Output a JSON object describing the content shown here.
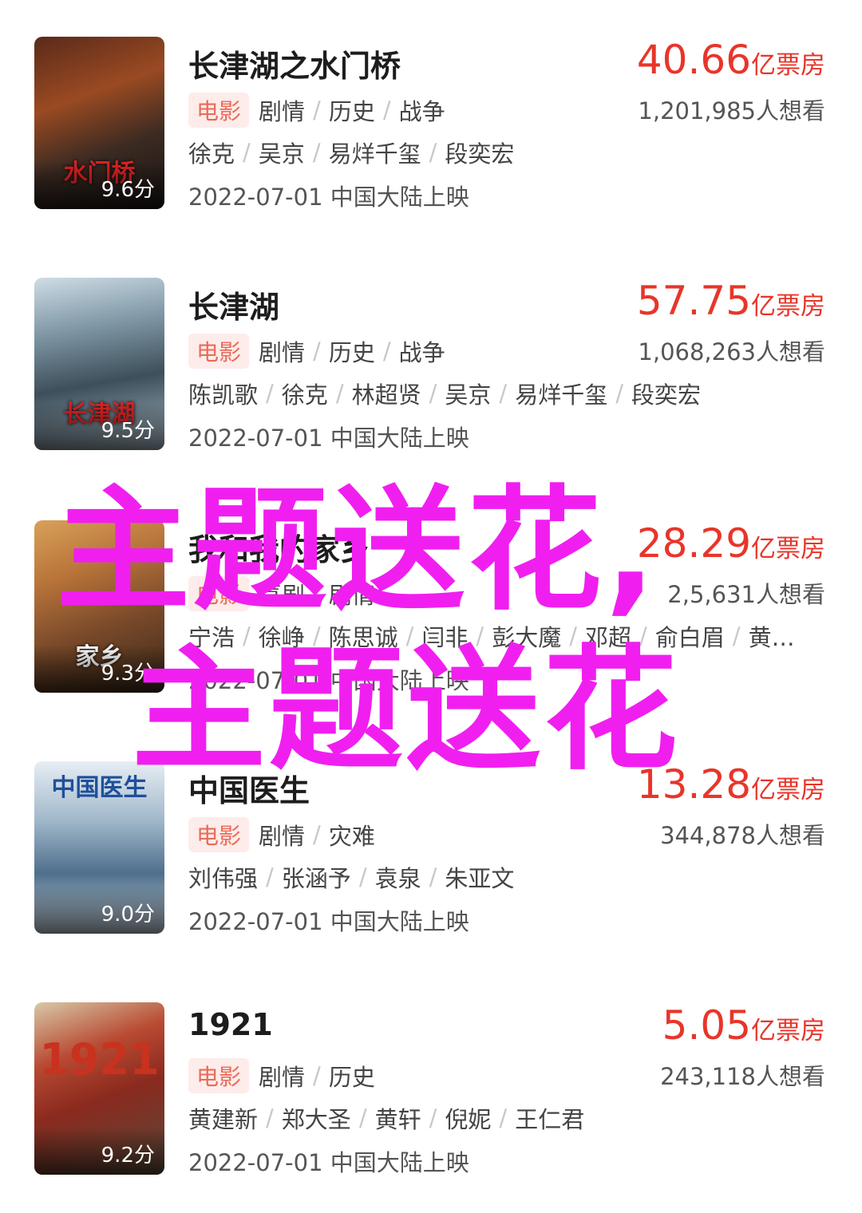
{
  "movies": [
    {
      "title": "长津湖之水门桥",
      "poster_title": "水门桥",
      "score": "9.6分",
      "tag": "电影",
      "genres": [
        "剧情",
        "历史",
        "战争"
      ],
      "cast": [
        "徐克",
        "吴京",
        "易烊千玺",
        "段奕宏"
      ],
      "release": "2022-07-01 中国大陆上映",
      "box_value": "40.66",
      "box_unit": "亿票房",
      "want": "1,201,985人想看"
    },
    {
      "title": "长津湖",
      "poster_title": "长津湖",
      "score": "9.5分",
      "tag": "电影",
      "genres": [
        "剧情",
        "历史",
        "战争"
      ],
      "cast": [
        "陈凯歌",
        "徐克",
        "林超贤",
        "吴京",
        "易烊千玺",
        "段奕宏"
      ],
      "release": "2022-07-01 中国大陆上映",
      "box_value": "57.75",
      "box_unit": "亿票房",
      "want": "1,068,263人想看"
    },
    {
      "title": "我和我的家乡",
      "poster_title": "家乡",
      "score": "9.3分",
      "tag": "电影",
      "genres": [
        "喜剧",
        "剧情"
      ],
      "cast": [
        "宁浩",
        "徐峥",
        "陈思诚",
        "闫非",
        "彭大魔",
        "邓超",
        "俞白眉",
        "黄…"
      ],
      "release": "2022-07-01 中国大陆上映",
      "box_value": "28.29",
      "box_unit": "亿票房",
      "want": "2,5,631人想看"
    },
    {
      "title": "中国医生",
      "poster_title": "中国医生",
      "score": "9.0分",
      "tag": "电影",
      "genres": [
        "剧情",
        "灾难"
      ],
      "cast": [
        "刘伟强",
        "张涵予",
        "袁泉",
        "朱亚文"
      ],
      "release": "2022-07-01 中国大陆上映",
      "box_value": "13.28",
      "box_unit": "亿票房",
      "want": "344,878人想看"
    },
    {
      "title": "1921",
      "poster_title": "1921",
      "score": "9.2分",
      "tag": "电影",
      "genres": [
        "剧情",
        "历史"
      ],
      "cast": [
        "黄建新",
        "郑大圣",
        "黄轩",
        "倪妮",
        "王仁君"
      ],
      "release": "2022-07-01 中国大陆上映",
      "box_value": "5.05",
      "box_unit": "亿票房",
      "want": "243,118人想看"
    }
  ],
  "watermark": {
    "line1": "主题送花,",
    "line2": "主题送花"
  },
  "colors": {
    "accent": "#e8352a",
    "tag_bg": "#fdecea",
    "tag_text": "#e96b5a",
    "watermark": "#f01ff0"
  }
}
